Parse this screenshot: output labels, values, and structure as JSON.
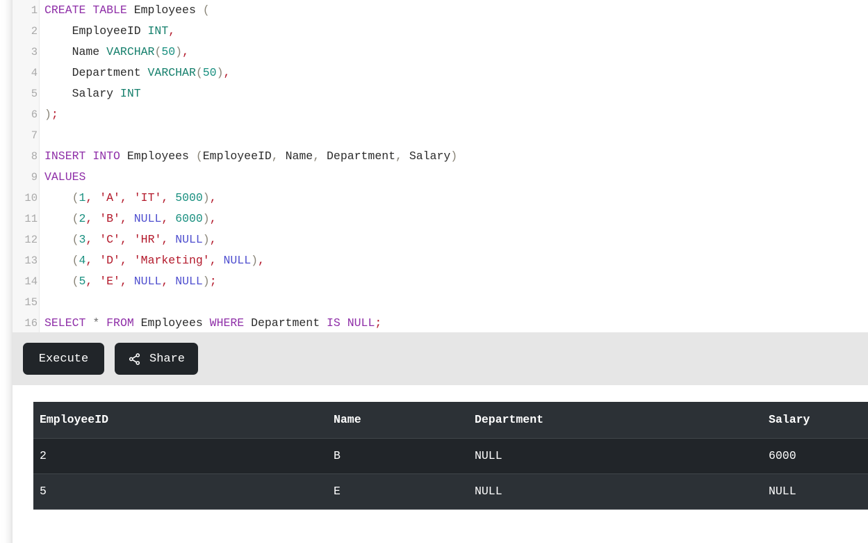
{
  "editor": {
    "language": "sql",
    "line_count": 16,
    "lines": [
      {
        "num": "1",
        "tokens": [
          {
            "t": "CREATE",
            "c": "kw"
          },
          {
            "t": " ",
            "c": "id"
          },
          {
            "t": "TABLE",
            "c": "kw"
          },
          {
            "t": " Employees ",
            "c": "id"
          },
          {
            "t": "(",
            "c": "pun"
          }
        ]
      },
      {
        "num": "2",
        "tokens": [
          {
            "t": "    EmployeeID ",
            "c": "id"
          },
          {
            "t": "INT",
            "c": "typ"
          },
          {
            "t": ",",
            "c": "str"
          }
        ]
      },
      {
        "num": "3",
        "tokens": [
          {
            "t": "    Name ",
            "c": "id"
          },
          {
            "t": "VARCHAR",
            "c": "typ"
          },
          {
            "t": "(",
            "c": "pun"
          },
          {
            "t": "50",
            "c": "num"
          },
          {
            "t": ")",
            "c": "pun"
          },
          {
            "t": ",",
            "c": "str"
          }
        ]
      },
      {
        "num": "4",
        "tokens": [
          {
            "t": "    Department ",
            "c": "id"
          },
          {
            "t": "VARCHAR",
            "c": "typ"
          },
          {
            "t": "(",
            "c": "pun"
          },
          {
            "t": "50",
            "c": "num"
          },
          {
            "t": ")",
            "c": "pun"
          },
          {
            "t": ",",
            "c": "str"
          }
        ]
      },
      {
        "num": "5",
        "tokens": [
          {
            "t": "    Salary ",
            "c": "id"
          },
          {
            "t": "INT",
            "c": "typ"
          }
        ]
      },
      {
        "num": "6",
        "tokens": [
          {
            "t": ")",
            "c": "pun"
          },
          {
            "t": ";",
            "c": "str"
          }
        ]
      },
      {
        "num": "7",
        "tokens": []
      },
      {
        "num": "8",
        "tokens": [
          {
            "t": "INSERT",
            "c": "kw"
          },
          {
            "t": " ",
            "c": "id"
          },
          {
            "t": "INTO",
            "c": "kw"
          },
          {
            "t": " Employees ",
            "c": "id"
          },
          {
            "t": "(",
            "c": "pun"
          },
          {
            "t": "EmployeeID",
            "c": "id"
          },
          {
            "t": ",",
            "c": "pun"
          },
          {
            "t": " Name",
            "c": "id"
          },
          {
            "t": ",",
            "c": "pun"
          },
          {
            "t": " Department",
            "c": "id"
          },
          {
            "t": ",",
            "c": "pun"
          },
          {
            "t": " Salary",
            "c": "id"
          },
          {
            "t": ")",
            "c": "pun"
          }
        ]
      },
      {
        "num": "9",
        "tokens": [
          {
            "t": "VALUES",
            "c": "kw"
          }
        ]
      },
      {
        "num": "10",
        "tokens": [
          {
            "t": "    ",
            "c": "id"
          },
          {
            "t": "(",
            "c": "pun"
          },
          {
            "t": "1",
            "c": "num"
          },
          {
            "t": ",",
            "c": "str"
          },
          {
            "t": " ",
            "c": "id"
          },
          {
            "t": "'A'",
            "c": "str"
          },
          {
            "t": ",",
            "c": "str"
          },
          {
            "t": " ",
            "c": "id"
          },
          {
            "t": "'IT'",
            "c": "str"
          },
          {
            "t": ",",
            "c": "str"
          },
          {
            "t": " ",
            "c": "id"
          },
          {
            "t": "5000",
            "c": "num"
          },
          {
            "t": ")",
            "c": "pun"
          },
          {
            "t": ",",
            "c": "str"
          }
        ]
      },
      {
        "num": "11",
        "tokens": [
          {
            "t": "    ",
            "c": "id"
          },
          {
            "t": "(",
            "c": "pun"
          },
          {
            "t": "2",
            "c": "num"
          },
          {
            "t": ",",
            "c": "str"
          },
          {
            "t": " ",
            "c": "id"
          },
          {
            "t": "'B'",
            "c": "str"
          },
          {
            "t": ",",
            "c": "str"
          },
          {
            "t": " ",
            "c": "id"
          },
          {
            "t": "NULL",
            "c": "nul"
          },
          {
            "t": ",",
            "c": "str"
          },
          {
            "t": " ",
            "c": "id"
          },
          {
            "t": "6000",
            "c": "num"
          },
          {
            "t": ")",
            "c": "pun"
          },
          {
            "t": ",",
            "c": "str"
          }
        ]
      },
      {
        "num": "12",
        "tokens": [
          {
            "t": "    ",
            "c": "id"
          },
          {
            "t": "(",
            "c": "pun"
          },
          {
            "t": "3",
            "c": "num"
          },
          {
            "t": ",",
            "c": "str"
          },
          {
            "t": " ",
            "c": "id"
          },
          {
            "t": "'C'",
            "c": "str"
          },
          {
            "t": ",",
            "c": "str"
          },
          {
            "t": " ",
            "c": "id"
          },
          {
            "t": "'HR'",
            "c": "str"
          },
          {
            "t": ",",
            "c": "str"
          },
          {
            "t": " ",
            "c": "id"
          },
          {
            "t": "NULL",
            "c": "nul"
          },
          {
            "t": ")",
            "c": "pun"
          },
          {
            "t": ",",
            "c": "str"
          }
        ]
      },
      {
        "num": "13",
        "tokens": [
          {
            "t": "    ",
            "c": "id"
          },
          {
            "t": "(",
            "c": "pun"
          },
          {
            "t": "4",
            "c": "num"
          },
          {
            "t": ",",
            "c": "str"
          },
          {
            "t": " ",
            "c": "id"
          },
          {
            "t": "'D'",
            "c": "str"
          },
          {
            "t": ",",
            "c": "str"
          },
          {
            "t": " ",
            "c": "id"
          },
          {
            "t": "'Marketing'",
            "c": "str"
          },
          {
            "t": ",",
            "c": "str"
          },
          {
            "t": " ",
            "c": "id"
          },
          {
            "t": "NULL",
            "c": "nul"
          },
          {
            "t": ")",
            "c": "pun"
          },
          {
            "t": ",",
            "c": "str"
          }
        ]
      },
      {
        "num": "14",
        "tokens": [
          {
            "t": "    ",
            "c": "id"
          },
          {
            "t": "(",
            "c": "pun"
          },
          {
            "t": "5",
            "c": "num"
          },
          {
            "t": ",",
            "c": "str"
          },
          {
            "t": " ",
            "c": "id"
          },
          {
            "t": "'E'",
            "c": "str"
          },
          {
            "t": ",",
            "c": "str"
          },
          {
            "t": " ",
            "c": "id"
          },
          {
            "t": "NULL",
            "c": "nul"
          },
          {
            "t": ",",
            "c": "str"
          },
          {
            "t": " ",
            "c": "id"
          },
          {
            "t": "NULL",
            "c": "nul"
          },
          {
            "t": ")",
            "c": "pun"
          },
          {
            "t": ";",
            "c": "str"
          }
        ]
      },
      {
        "num": "15",
        "tokens": []
      },
      {
        "num": "16",
        "tokens": [
          {
            "t": "SELECT",
            "c": "kw"
          },
          {
            "t": " ",
            "c": "id"
          },
          {
            "t": "*",
            "c": "op"
          },
          {
            "t": " ",
            "c": "id"
          },
          {
            "t": "FROM",
            "c": "kw"
          },
          {
            "t": " Employees ",
            "c": "id"
          },
          {
            "t": "WHERE",
            "c": "kw"
          },
          {
            "t": " Department ",
            "c": "id"
          },
          {
            "t": "IS",
            "c": "kw"
          },
          {
            "t": " ",
            "c": "id"
          },
          {
            "t": "NULL",
            "c": "kw"
          },
          {
            "t": ";",
            "c": "str"
          }
        ]
      }
    ],
    "plain_text": "CREATE TABLE Employees (\n    EmployeeID INT,\n    Name VARCHAR(50),\n    Department VARCHAR(50),\n    Salary INT\n);\n\nINSERT INTO Employees (EmployeeID, Name, Department, Salary)\nVALUES\n    (1, 'A', 'IT', 5000),\n    (2, 'B', NULL, 6000),\n    (3, 'C', 'HR', NULL),\n    (4, 'D', 'Marketing', NULL),\n    (5, 'E', NULL, NULL);\n\nSELECT * FROM Employees WHERE Department IS NULL;"
  },
  "toolbar": {
    "execute_label": "Execute",
    "share_label": "Share",
    "share_icon": "share-nodes-icon",
    "background": "#e6e6e6",
    "button_color": "#212529"
  },
  "results": {
    "columns": [
      "EmployeeID",
      "Name",
      "Department",
      "Salary"
    ],
    "rows": [
      [
        "2",
        "B",
        "NULL",
        "6000"
      ],
      [
        "5",
        "E",
        "NULL",
        "NULL"
      ]
    ],
    "header_bg": "#2c3136",
    "row_odd_bg": "#212529",
    "row_even_bg": "#2c3136",
    "text_color": "#ffffff"
  }
}
